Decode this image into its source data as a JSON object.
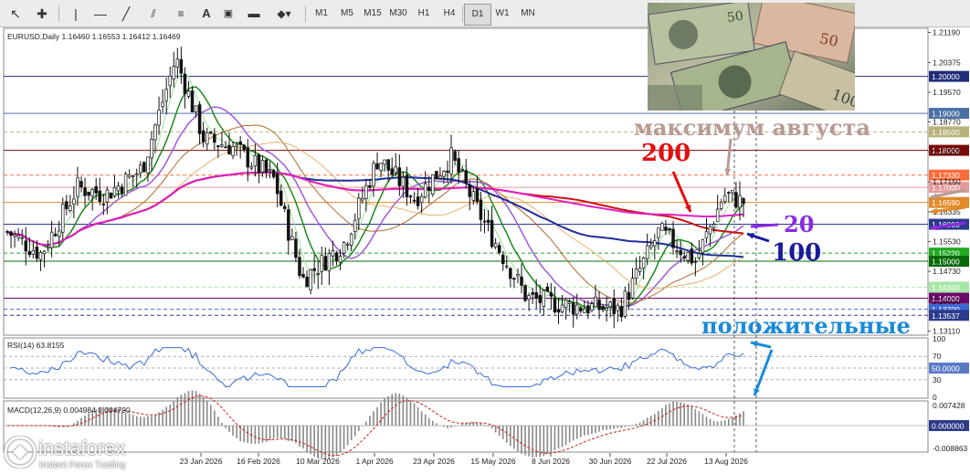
{
  "toolbar": {
    "timeframes": [
      "M1",
      "M5",
      "M15",
      "M30",
      "H1",
      "H4",
      "D1",
      "W1",
      "MN"
    ]
  },
  "chart_data": {
    "type": "candlestick",
    "symbol_line": "EURUSD,Daily  1.16460 1.16553 1.16412 1.16469",
    "price_range": [
      1.13,
      1.213
    ],
    "price_ticks": [
      "1.21190",
      "1.20375",
      "1.19570",
      "1.18770",
      "1.17955",
      "1.17150",
      "1.16335",
      "1.15530",
      "1.14730",
      "1.13920",
      "1.13110"
    ],
    "levels": [
      {
        "label": "1.20000",
        "value": 1.2,
        "color": "#1f2d7a",
        "line": "solid"
      },
      {
        "label": "1.19000",
        "value": 1.19,
        "color": "#4a6fa5",
        "line": "solid"
      },
      {
        "label": "1.18500",
        "value": 1.185,
        "color": "#b8b27a",
        "line": "dashed"
      },
      {
        "label": "1.18000",
        "value": 1.18,
        "color": "#7a0a0a",
        "line": "solid"
      },
      {
        "label": "1.17330",
        "value": 1.1733,
        "color": "#ff6b3a",
        "line": "dashed"
      },
      {
        "label": "1.17000",
        "value": 1.17,
        "color": "#e49a9a",
        "line": "solid"
      },
      {
        "label": "1.16590",
        "value": 1.1659,
        "color": "#e08a2a",
        "line": "solid"
      },
      {
        "label": "1.16000",
        "value": 1.16,
        "color": "#2b3a8a",
        "line": "solid"
      },
      {
        "label": "1.15220",
        "value": 1.1522,
        "color": "#22aa22",
        "line": "dashed"
      },
      {
        "label": "1.15000",
        "value": 1.15,
        "color": "#0a6a0a",
        "line": "solid"
      },
      {
        "label": "1.14300",
        "value": 1.143,
        "color": "#a8e6a8",
        "line": "dashed"
      },
      {
        "label": "1.14000",
        "value": 1.14,
        "color": "#6a0a6a",
        "line": "solid"
      },
      {
        "label": "1.13700",
        "value": 1.137,
        "color": "#3b6ad8",
        "line": "dashed"
      },
      {
        "label": "1.13537",
        "value": 1.13537,
        "color": "#2b3a8a",
        "line": "dashed"
      }
    ],
    "date_labels": [
      "23 Jan 2026",
      "16 Feb 2026",
      "10 Mar 2026",
      "1 Apr 2026",
      "23 Apr 2026",
      "15 May 2026",
      "8 Jun 2026",
      "30 Jun 2026",
      "22 Jul 2026",
      "13 Aug 2026"
    ],
    "moving_averages": [
      {
        "period": 20,
        "color": "#1f2d7a"
      },
      {
        "period": 100,
        "color": "#2b2bb0"
      },
      {
        "period": 200,
        "color": "#cc1010"
      }
    ],
    "rsi": {
      "label": "RSI(14) 63.8155",
      "ticks": [
        "100",
        "70",
        "50",
        "30",
        "0"
      ],
      "level_label": "50.0000"
    },
    "macd": {
      "label": "MACD(12,26,9) 0.004984 0.004790",
      "ticks": [
        "0.007428",
        "0.000000",
        "-0.008863"
      ]
    }
  },
  "annotations": {
    "max_august": "максимум августа",
    "ma200": "200",
    "ma20": "20",
    "ma100": "100",
    "positive": "положительные"
  },
  "logo": {
    "name": "instaforex",
    "tagline": "Instant Forex Trading"
  }
}
